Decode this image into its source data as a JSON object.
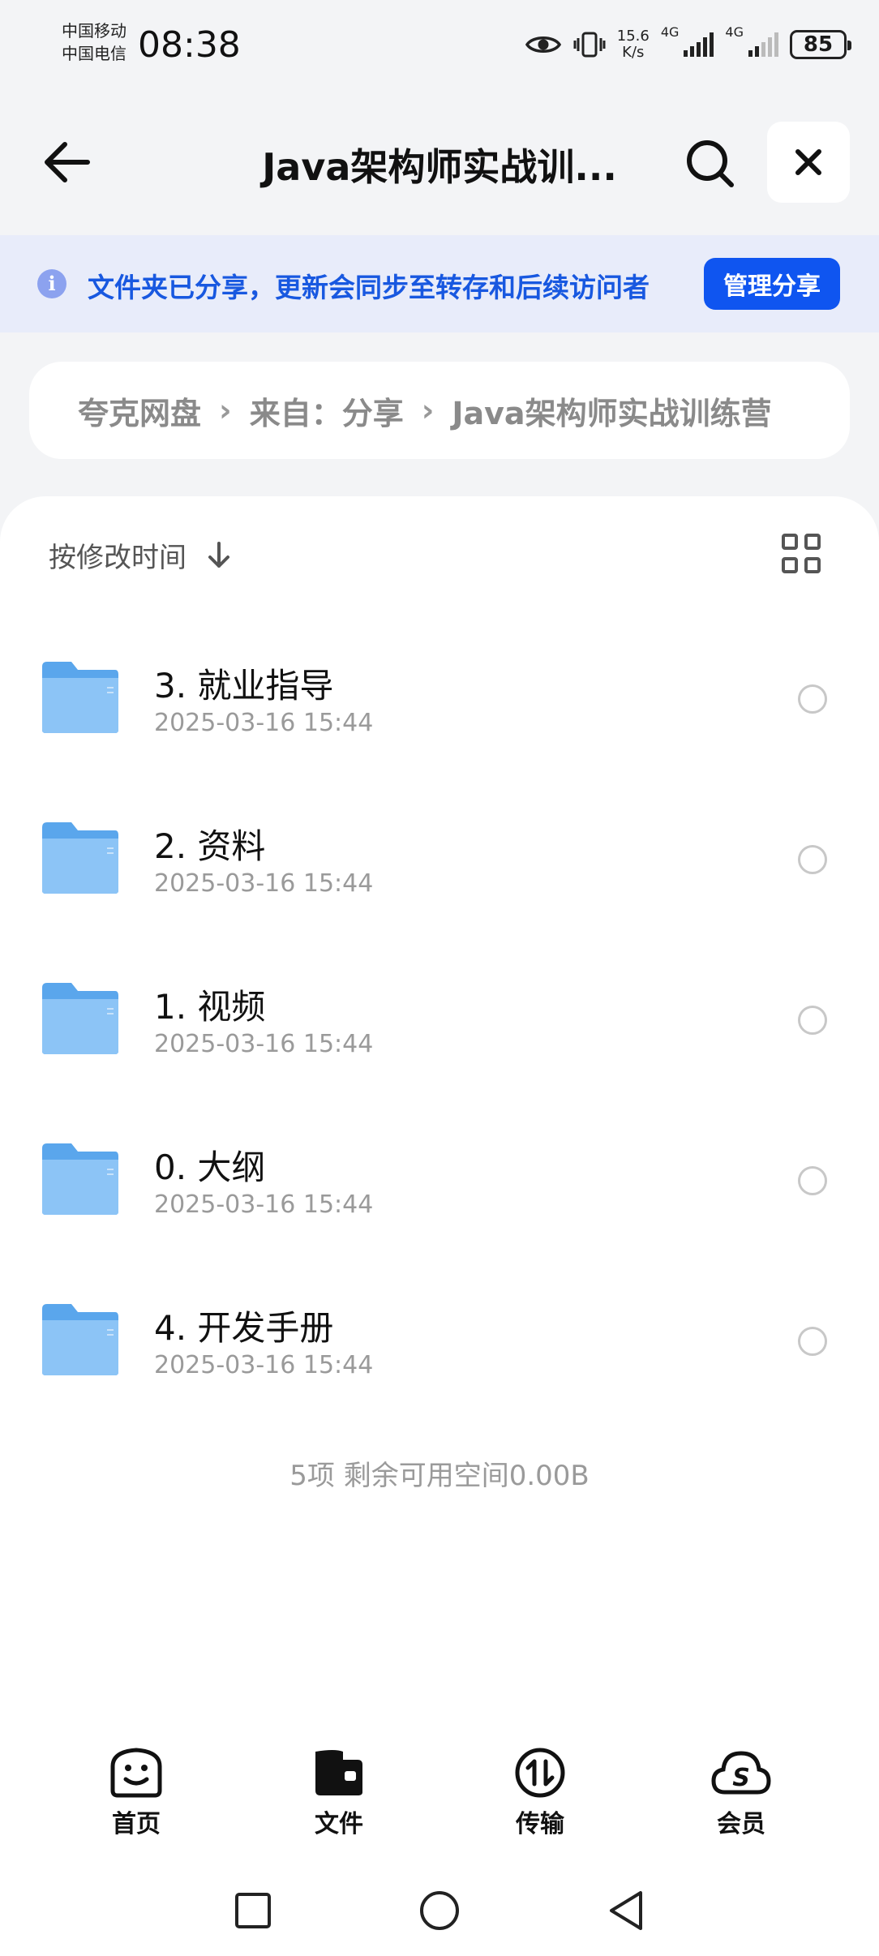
{
  "status_bar": {
    "carrier_1": "中国移动",
    "carrier_2": "中国电信",
    "time": "08:38",
    "speed_value": "15.6",
    "speed_unit": "K/s",
    "net_1": "4G",
    "net_2": "4G",
    "battery": "85"
  },
  "header": {
    "title": "Java架构师实战训...",
    "icons": [
      "back-arrow-icon",
      "search-icon",
      "close-icon"
    ]
  },
  "share_banner": {
    "text": "文件夹已分享，更新会同步至转存和后续访问者",
    "button": "管理分享",
    "icon": "info-icon"
  },
  "breadcrumb": {
    "items": [
      "夸克网盘",
      "来自：分享",
      "Java架构师实战训练营"
    ]
  },
  "list": {
    "sort_label": "按修改时间",
    "items": [
      {
        "name": "3. 就业指导",
        "date": "2025-03-16 15:44"
      },
      {
        "name": "2. 资料",
        "date": "2025-03-16 15:44"
      },
      {
        "name": "1. 视频",
        "date": "2025-03-16 15:44"
      },
      {
        "name": "0. 大纲",
        "date": "2025-03-16 15:44"
      },
      {
        "name": "4. 开发手册",
        "date": "2025-03-16 15:44"
      }
    ],
    "summary": "5项 剩余可用空间0.00B"
  },
  "bottom_nav": {
    "items": [
      {
        "label": "首页",
        "icon": "home-face-icon"
      },
      {
        "label": "文件",
        "icon": "wallet-folder-icon"
      },
      {
        "label": "传输",
        "icon": "transfer-icon"
      },
      {
        "label": "会员",
        "icon": "vip-cloud-icon"
      }
    ]
  },
  "colors": {
    "accent": "#0f55f0",
    "banner_bg": "#e8ecfa",
    "banner_text": "#1858e0",
    "folder": "#6aaef0"
  }
}
